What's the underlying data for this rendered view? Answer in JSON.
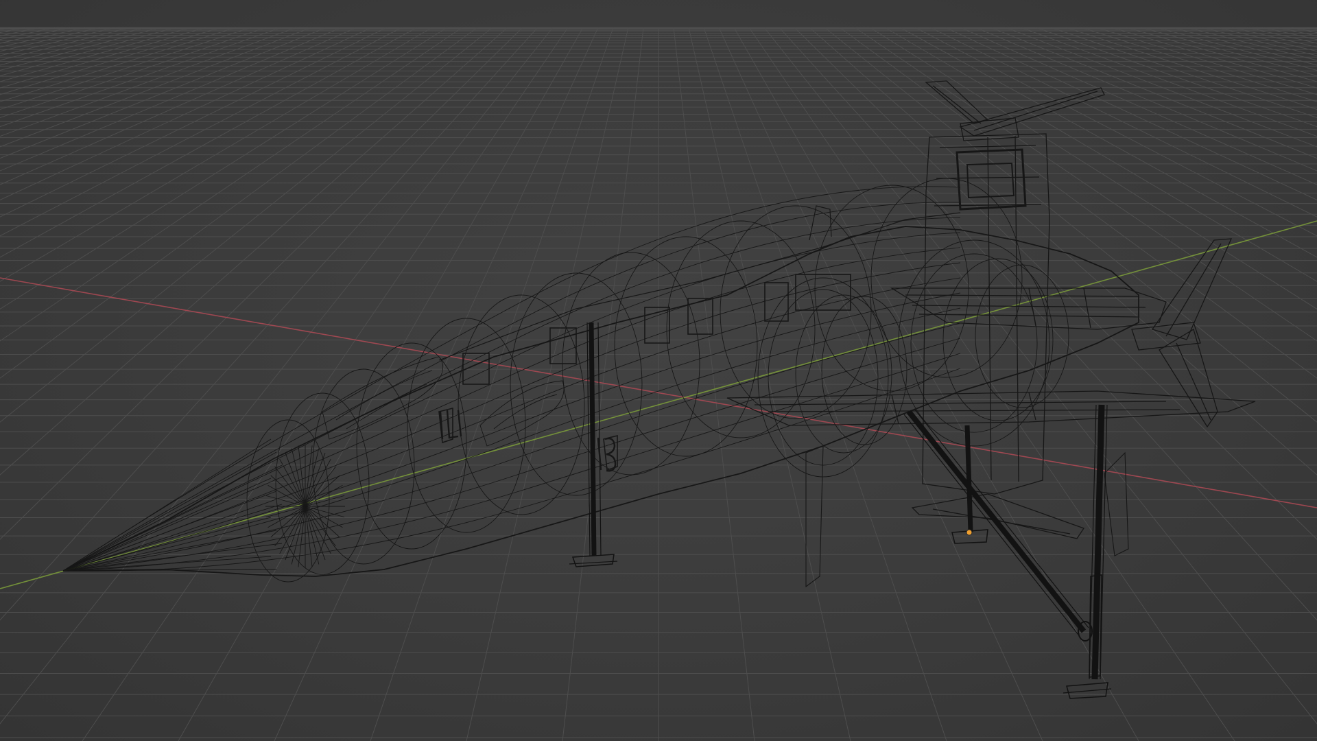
{
  "viewport": {
    "mode": "wireframe",
    "colors": {
      "background": "#3b3b3b",
      "grid_line": "#4e4e4e",
      "x_axis": "#b04a55",
      "y_axis": "#7ea03a",
      "wire": "#141414",
      "origin_marker": "#f0a030"
    },
    "object": {
      "icon": "aircraft-wireframe-icon"
    }
  }
}
